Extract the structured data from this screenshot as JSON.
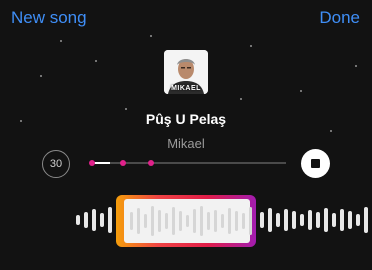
{
  "header": {
    "left_label": "New song",
    "right_label": "Done"
  },
  "album": {
    "cover_text": "MIKAEL"
  },
  "song": {
    "title": "Pûş U Pelaş",
    "artist": "Mikael"
  },
  "controls": {
    "duration_label": "30",
    "progress_fraction": 0.1,
    "marker_fractions": [
      0.0,
      0.16,
      0.3
    ]
  },
  "colors": {
    "accent": "#3f8ef6",
    "marker": "#e0218a",
    "selection_gradient": [
      "#f59e0b",
      "#ef4444",
      "#e11d48",
      "#a21caf"
    ]
  },
  "icons": {
    "duration": "timer-30-icon",
    "stop": "stop-icon"
  }
}
